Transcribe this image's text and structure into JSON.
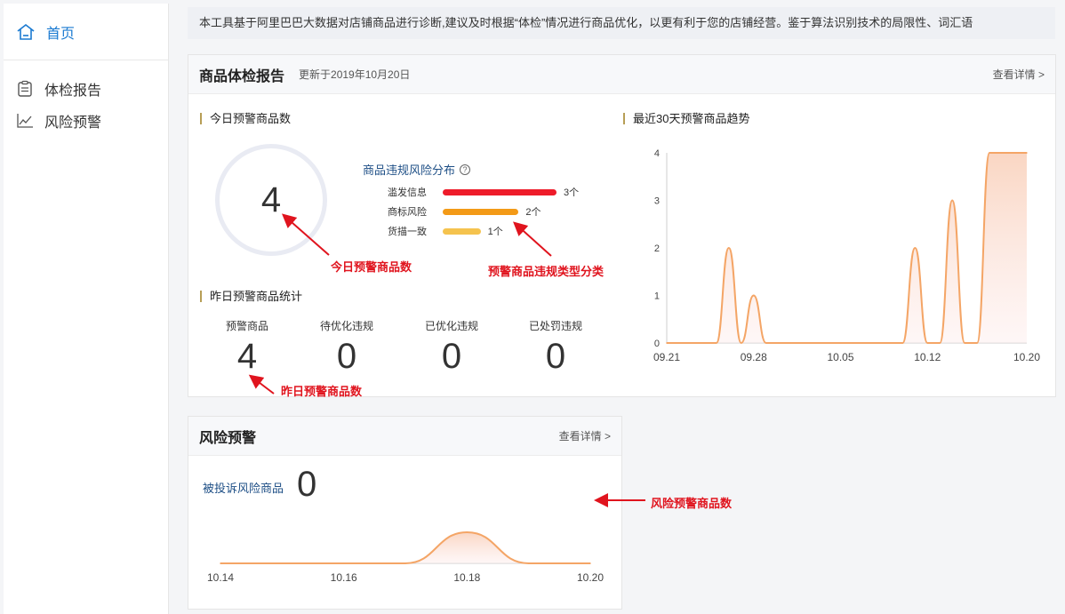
{
  "sidebar": {
    "home": {
      "label": "首页"
    },
    "items": [
      {
        "label": "体检报告",
        "icon": "report-icon"
      },
      {
        "label": "风险预警",
        "icon": "trend-icon"
      }
    ]
  },
  "notice": "本工具基于阿里巴巴大数据对店铺商品进行诊断,建议及时根据“体检”情况进行商品优化，以更有利于您的店铺经营。鉴于算法识别技术的局限性、词汇语",
  "report": {
    "title": "商品体检报告",
    "updated": "更新于2019年10月20日",
    "detail_link": "查看详情 >",
    "today_title": "今日预警商品数",
    "today_value": "4",
    "dist_title": "商品违规风险分布",
    "dist": [
      {
        "label": "滥发信息",
        "value": 3,
        "value_label": "3个",
        "color": "#ee1c2a"
      },
      {
        "label": "商标风险",
        "value": 2,
        "value_label": "2个",
        "color": "#f39a17"
      },
      {
        "label": "货描一致",
        "value": 1,
        "value_label": "1个",
        "color": "#f5c34e"
      }
    ],
    "yesterday_title": "昨日预警商品统计",
    "stats": [
      {
        "label": "预警商品",
        "value": "4"
      },
      {
        "label": "待优化违规",
        "value": "0"
      },
      {
        "label": "已优化违规",
        "value": "0"
      },
      {
        "label": "已处罚违规",
        "value": "0"
      }
    ],
    "trend_title": "最近30天预警商品趋势"
  },
  "risk": {
    "title": "风险预警",
    "detail_link": "查看详情 >",
    "label": "被投诉风险商品",
    "value": "0"
  },
  "annotations": {
    "today": "今日预警商品数",
    "types": "预警商品违规类型分类",
    "yesterday": "昨日预警商品数",
    "risk": "风险预警商品数"
  },
  "colors": {
    "accent": "#1a7ad1",
    "line": "#f4a566",
    "annotation": "#e0141e"
  },
  "chart_data": [
    {
      "type": "area",
      "title": "最近30天预警商品趋势",
      "x_ticks": [
        "09.21",
        "09.28",
        "10.05",
        "10.12",
        "10.20"
      ],
      "y_ticks": [
        0,
        1,
        2,
        3,
        4
      ],
      "ylim": [
        0,
        4
      ],
      "x": [
        "09.21",
        "09.22",
        "09.23",
        "09.24",
        "09.25",
        "09.26",
        "09.27",
        "09.28",
        "09.29",
        "09.30",
        "10.01",
        "10.02",
        "10.03",
        "10.04",
        "10.05",
        "10.06",
        "10.07",
        "10.08",
        "10.09",
        "10.10",
        "10.11",
        "10.12",
        "10.13",
        "10.14",
        "10.15",
        "10.16",
        "10.17",
        "10.18",
        "10.19",
        "10.20"
      ],
      "values": [
        0,
        0,
        0,
        0,
        0,
        2,
        0,
        1,
        0,
        0,
        0,
        0,
        0,
        0,
        0,
        0,
        0,
        0,
        0,
        0,
        2,
        0,
        0,
        3,
        0,
        0,
        4,
        4,
        4,
        4
      ],
      "grid": false
    },
    {
      "type": "area",
      "x_ticks": [
        "10.14",
        "10.16",
        "10.18",
        "10.20"
      ],
      "x": [
        "10.14",
        "10.15",
        "10.16",
        "10.17",
        "10.18",
        "10.19",
        "10.20"
      ],
      "values": [
        0,
        0,
        0,
        0,
        1,
        0,
        0
      ],
      "grid": false
    }
  ]
}
